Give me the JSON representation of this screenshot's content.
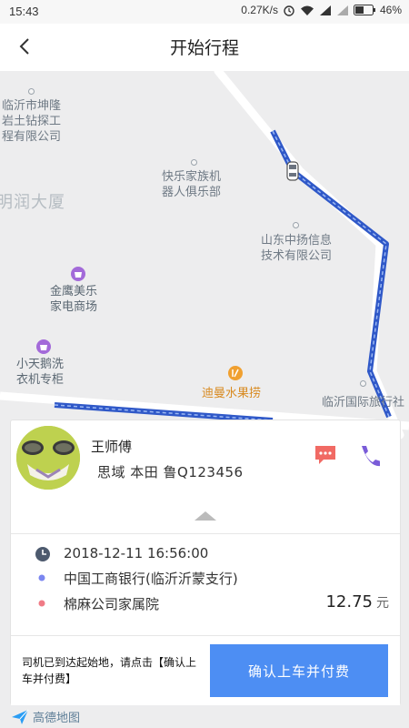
{
  "status_bar": {
    "time": "15:43",
    "network_speed": "0.27K/s",
    "battery": "46%"
  },
  "nav": {
    "title": "开始行程",
    "back_icon": "chevron-left-icon"
  },
  "map": {
    "pois": [
      {
        "lines": [
          "临沂市坤隆",
          "岩土钻探工",
          "程有限公司"
        ]
      },
      {
        "lines": [
          "快乐家族机",
          "器人俱乐部"
        ]
      },
      {
        "lines": [
          "山东中扬信息",
          "技术有限公司"
        ]
      },
      {
        "lines": [
          "金鹰美乐",
          "家电商场"
        ]
      },
      {
        "lines": [
          "小天鹅洗",
          "衣机专柜"
        ]
      },
      {
        "lines": [
          "迪曼水果捞"
        ]
      },
      {
        "lines": [
          "临沂国际旅行社"
        ]
      },
      {
        "lines": [
          "明润大厦"
        ]
      }
    ],
    "route_color": "#3d6fe0",
    "logo_text": "高德地图"
  },
  "driver": {
    "name": "王师傅",
    "car": "思域  本田  鲁Q123456",
    "message_icon": "chat-bubble-icon",
    "call_icon": "phone-icon"
  },
  "trip": {
    "time": "2018-12-11 16:56:00",
    "origin": "中国工商银行(临沂沂蒙支行)",
    "destination": "棉麻公司家属院",
    "price": "12.75",
    "price_unit": "元",
    "origin_color": "#7b86f0",
    "destination_color": "#f07b86"
  },
  "footer": {
    "hint": "司机已到达起始地，请点击【确认上车并付费】",
    "confirm_label": "确认上车并付费",
    "accent": "#4d8ef3"
  }
}
